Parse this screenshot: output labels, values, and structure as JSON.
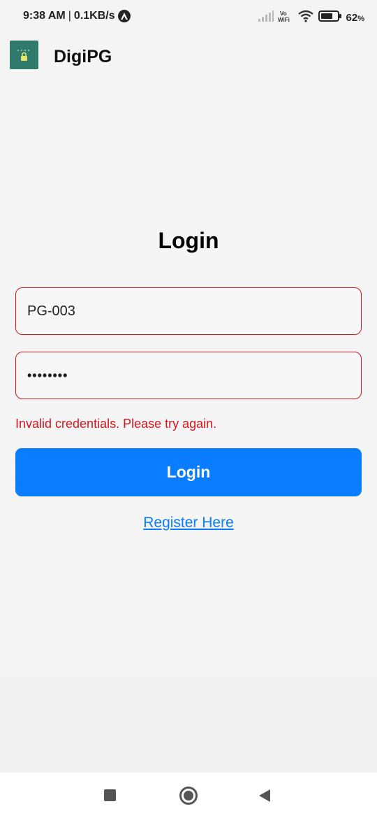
{
  "status_bar": {
    "time": "9:38 AM",
    "separator": "|",
    "network_speed": "0.1KB/s",
    "battery": "62",
    "battery_unit": "%"
  },
  "app_bar": {
    "title": "DigiPG"
  },
  "login": {
    "heading": "Login",
    "username_value": "PG-003",
    "password_mask": "••••••••",
    "error_message": "Invalid credentials. Please try again.",
    "login_button_label": "Login",
    "register_link_label": "Register Here"
  },
  "colors": {
    "accent": "#0a7cff",
    "error": "#d9141c",
    "background": "#f4f4f4",
    "logo_bg": "#2f7a6a"
  },
  "icons": [
    "alert-icon",
    "signal-icon",
    "vowifi-icon",
    "wifi-icon",
    "battery-icon",
    "app-logo-icon",
    "nav-recent-icon",
    "nav-home-icon",
    "nav-back-icon"
  ]
}
